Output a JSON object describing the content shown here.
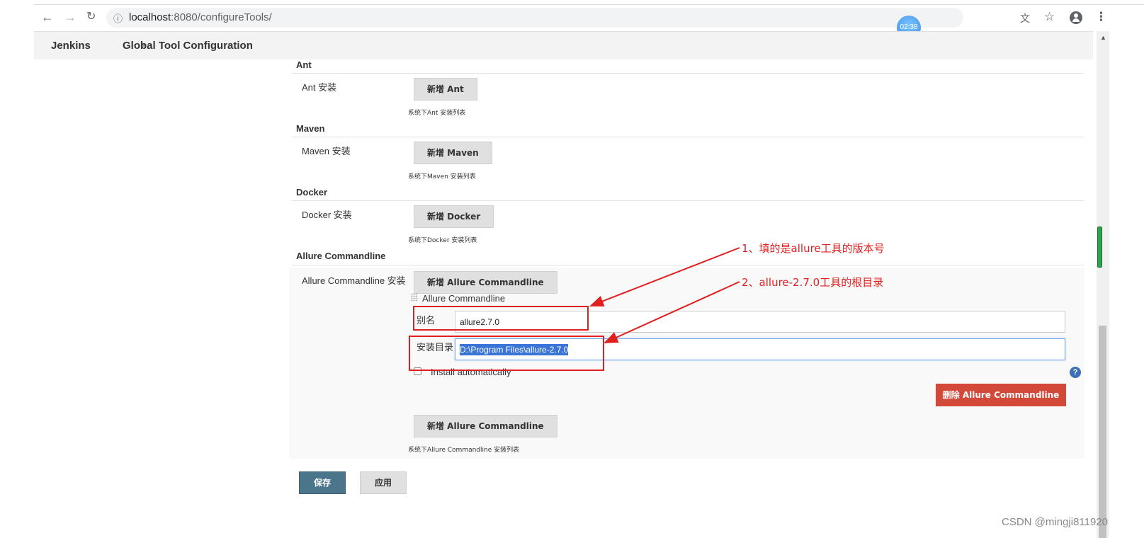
{
  "browser": {
    "url_host": "localhost",
    "url_rest": ":8080/configureTools/",
    "time_badge": "02:38"
  },
  "breadcrumb": {
    "root": "Jenkins",
    "current": "Global Tool Configuration"
  },
  "sections": {
    "ant": {
      "title": "Ant",
      "install_label": "Ant 安装",
      "add_button": "新增 Ant",
      "hint": "系统下Ant 安装列表"
    },
    "maven": {
      "title": "Maven",
      "install_label": "Maven 安装",
      "add_button": "新增 Maven",
      "hint": "系统下Maven 安装列表"
    },
    "docker": {
      "title": "Docker",
      "install_label": "Docker 安装",
      "add_button": "新增 Docker",
      "hint": "系统下Docker 安装列表"
    },
    "allure": {
      "title": "Allure Commandline",
      "install_label": "Allure Commandline 安装",
      "add_button": "新增 Allure Commandline",
      "repeat_title": "Allure Commandline",
      "alias_label": "别名",
      "alias_value": "allure2.7.0",
      "home_label": "安装目录",
      "home_value": "D:\\Program Files\\allure-2.7.0",
      "install_auto_label": "Install automatically",
      "install_auto_checked": false,
      "help": "?",
      "delete_button": "删除 Allure Commandline",
      "add_button_bottom": "新增 Allure Commandline",
      "hint": "系统下Allure Commandline 安装列表"
    }
  },
  "footer": {
    "save": "保存",
    "apply": "应用"
  },
  "annotations": {
    "note1": "1、填的是allure工具的版本号",
    "note2": "2、allure-2.7.0工具的根目录",
    "color": "#e02020"
  },
  "watermark": "CSDN @mingji811920"
}
